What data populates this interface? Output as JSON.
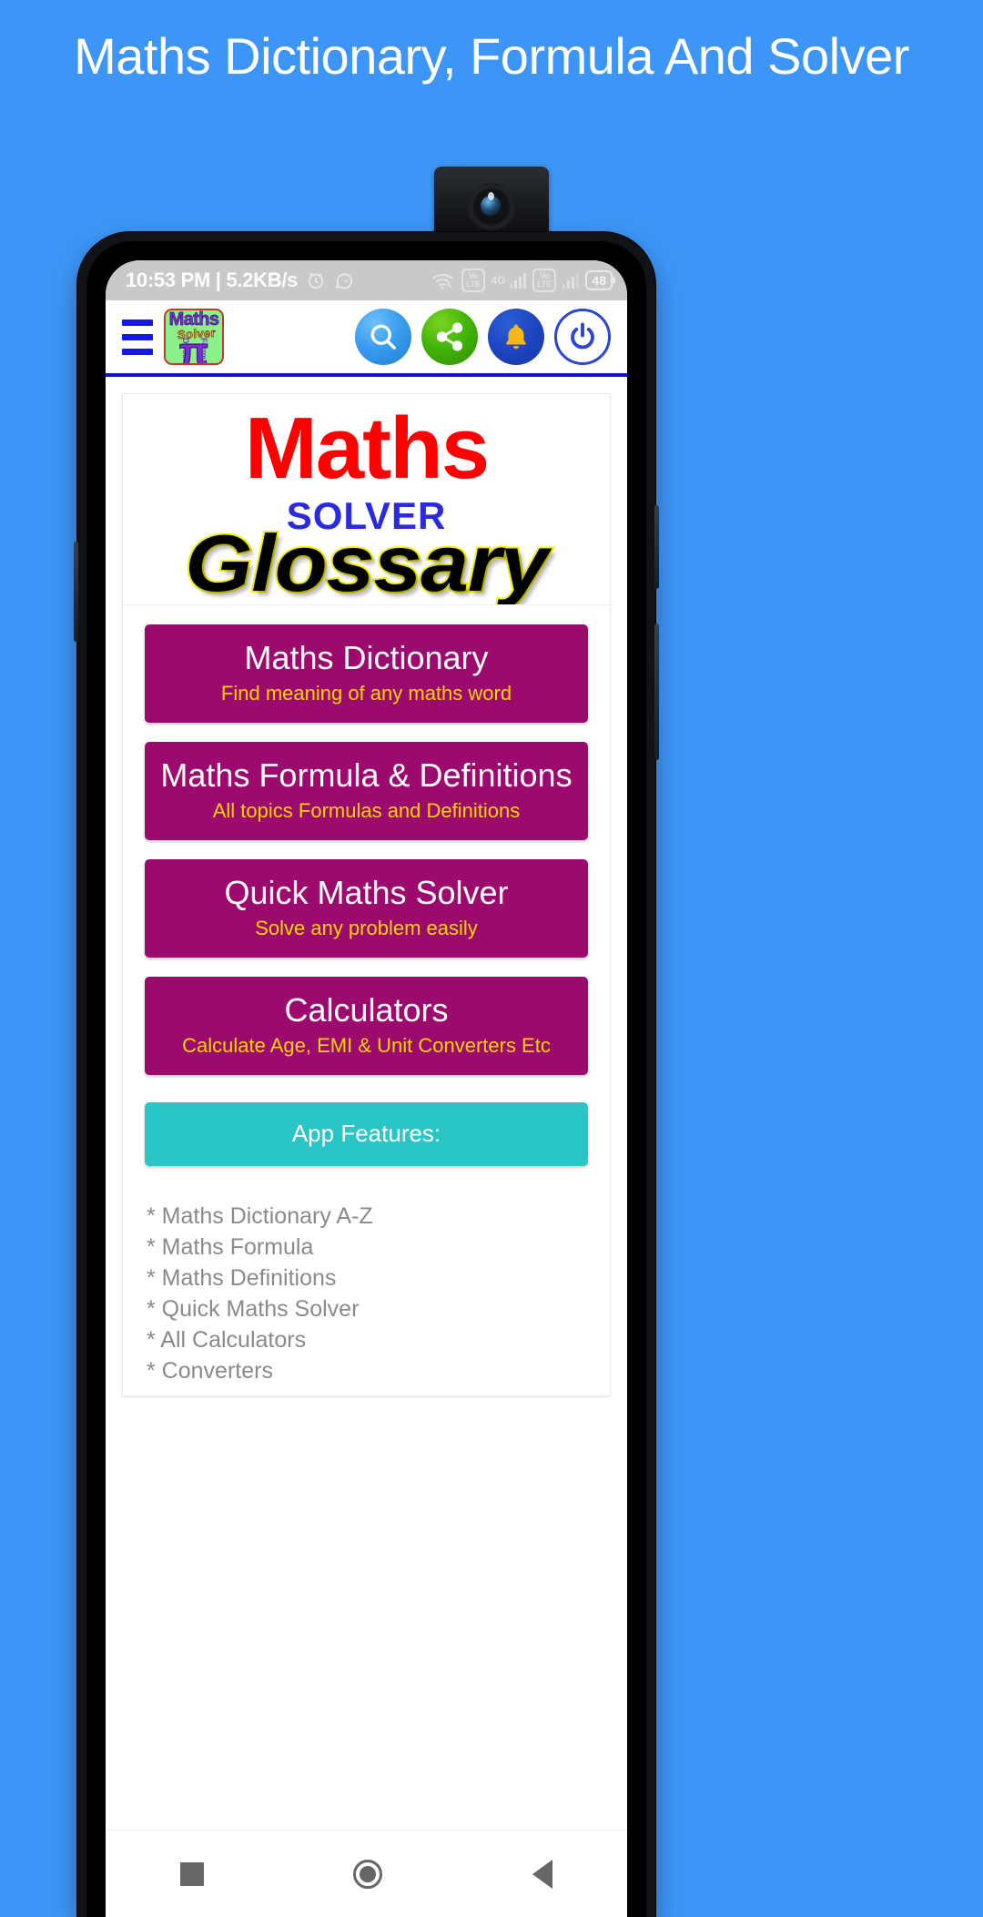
{
  "promo": {
    "title": "Maths Dictionary, Formula And Solver",
    "background_color": "#3d96f7"
  },
  "status_bar": {
    "time_and_speed": "10:53 PM | 5.2KB/s",
    "alarm_icon": "alarm-clock-icon",
    "whatsapp_icon": "whatsapp-icon",
    "wifi_icon": "wifi-icon",
    "volte_label_1": "Vo",
    "volte_label_2": "LTE",
    "network_type": "4G",
    "volte2_label_1": "Vo",
    "volte2_label_2": "LTE",
    "battery_percent": "48",
    "background_color": "#c9c9c9"
  },
  "app_bar": {
    "menu_icon": "hamburger-menu-icon",
    "logo": {
      "brand": "Maths",
      "sub_brand": "Solver",
      "symbol": "π",
      "left_word": "Dictionary",
      "right_word": "Formula"
    },
    "actions": [
      {
        "name": "search",
        "icon": "search-icon",
        "color": "#3a9ded"
      },
      {
        "name": "share",
        "icon": "share-icon",
        "color": "#43b50a"
      },
      {
        "name": "notifications",
        "icon": "bell-icon",
        "color": "#1f47c2"
      },
      {
        "name": "exit",
        "icon": "power-icon",
        "color": "#2b45d6"
      }
    ],
    "accent_underline": "#1414d0"
  },
  "banner": {
    "line1": "Maths",
    "line2": "SOLVER",
    "line3": "Glossary",
    "line1_color": "#ff0000",
    "line2_color": "#2b2bdd",
    "line3_color": "#000000",
    "line3_outline": "#f5f000"
  },
  "menu_buttons": [
    {
      "title": "Maths Dictionary",
      "subtitle": "Find meaning of any maths word"
    },
    {
      "title": "Maths Formula & Definitions",
      "subtitle": "All topics Formulas and Definitions"
    },
    {
      "title": "Quick Maths Solver",
      "subtitle": "Solve any problem easily"
    },
    {
      "title": "Calculators",
      "subtitle": "Calculate Age, EMI & Unit Converters Etc"
    }
  ],
  "menu_button_color": "#9c0a6e",
  "menu_button_title_color": "#ffffff",
  "menu_button_subtitle_color": "#ffd400",
  "features_header": {
    "label": "App Features:",
    "color": "#2ac6c6"
  },
  "features_list": [
    "* Maths Dictionary A-Z",
    "* Maths Formula",
    "* Maths Definitions",
    "* Quick Maths Solver",
    "* All Calculators",
    "* Converters"
  ],
  "nav_bar": {
    "recents_icon": "square-recents-icon",
    "home_icon": "circle-home-icon",
    "back_icon": "triangle-back-icon"
  }
}
